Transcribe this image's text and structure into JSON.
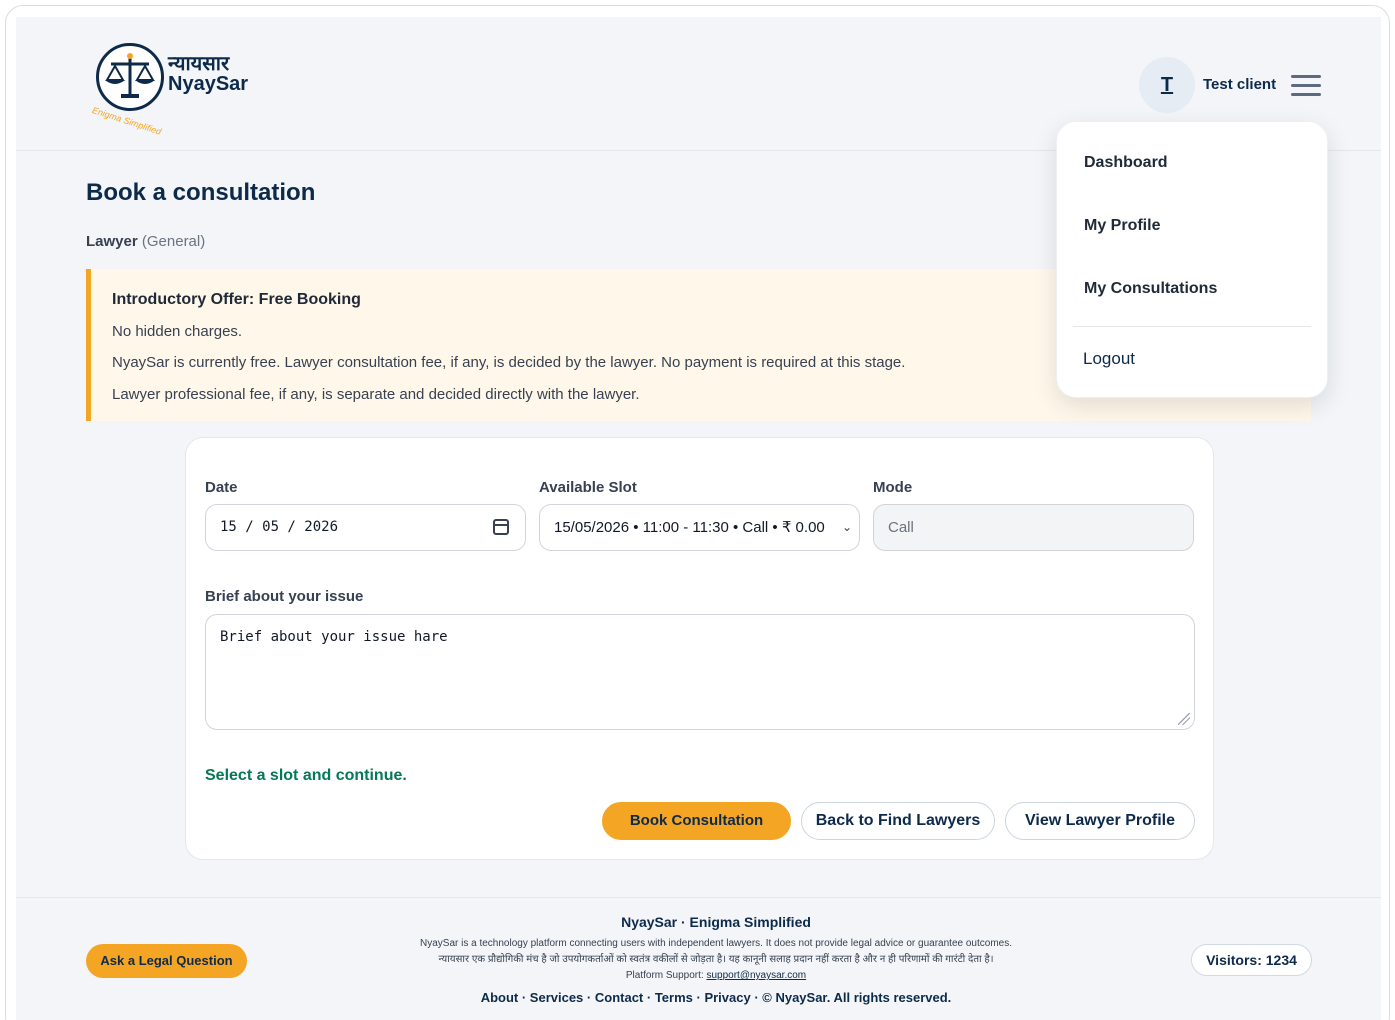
{
  "brand": {
    "hindi_name": "न्यायसार",
    "name": "NyaySar",
    "tagline": "Enigma Simplified"
  },
  "user": {
    "initial": "T",
    "name": "Test client"
  },
  "menu": {
    "items": [
      "Dashboard",
      "My Profile",
      "My Consultations"
    ],
    "logout": "Logout"
  },
  "page": {
    "title": "Book a consultation",
    "lawyer_label": "Lawyer",
    "lawyer_type": "(General)"
  },
  "offer": {
    "title": "Introductory Offer: Free Booking",
    "lines": [
      "No hidden charges.",
      "NyaySar is currently free. Lawyer consultation fee, if any, is decided by the lawyer. No payment is required at this stage.",
      "Lawyer professional fee, if any, is separate and decided directly with the lawyer."
    ]
  },
  "form": {
    "date_label": "Date",
    "date_value": "15 / 05 / 2026",
    "slot_label": "Available Slot",
    "slot_value": "15/05/2026 • 11:00 - 11:30 • Call • ₹ 0.00",
    "mode_label": "Mode",
    "mode_value": "Call",
    "issue_label": "Brief about your issue",
    "issue_placeholder": "Brief about your issue hare",
    "status": "Select a slot and continue.",
    "book_button": "Book Consultation",
    "back_button": "Back to Find Lawyers",
    "profile_button": "View Lawyer Profile"
  },
  "footer": {
    "ask_button": "Ask a Legal Question",
    "title": "NyaySar · Enigma Simplified",
    "disclaimer_en": "NyaySar is a technology platform connecting users with independent lawyers. It does not provide legal advice or guarantee outcomes.",
    "disclaimer_hi": "न्यायसार एक प्रौद्योगिकी मंच है जो उपयोगकर्ताओं को स्वतंत्र वकीलों से जोड़ता है। यह कानूनी सलाह प्रदान नहीं करता है और न ही परिणामों की गारंटी देता है।",
    "support_label": "Platform Support:",
    "support_email": "support@nyaysar.com",
    "links": [
      "About",
      "Services",
      "Contact",
      "Terms",
      "Privacy"
    ],
    "copyright": "© NyaySar. All rights reserved.",
    "visitors": "Visitors: 1234"
  },
  "colors": {
    "navy": "#0d2a4a",
    "accent": "#f5a524",
    "success": "#047857"
  }
}
